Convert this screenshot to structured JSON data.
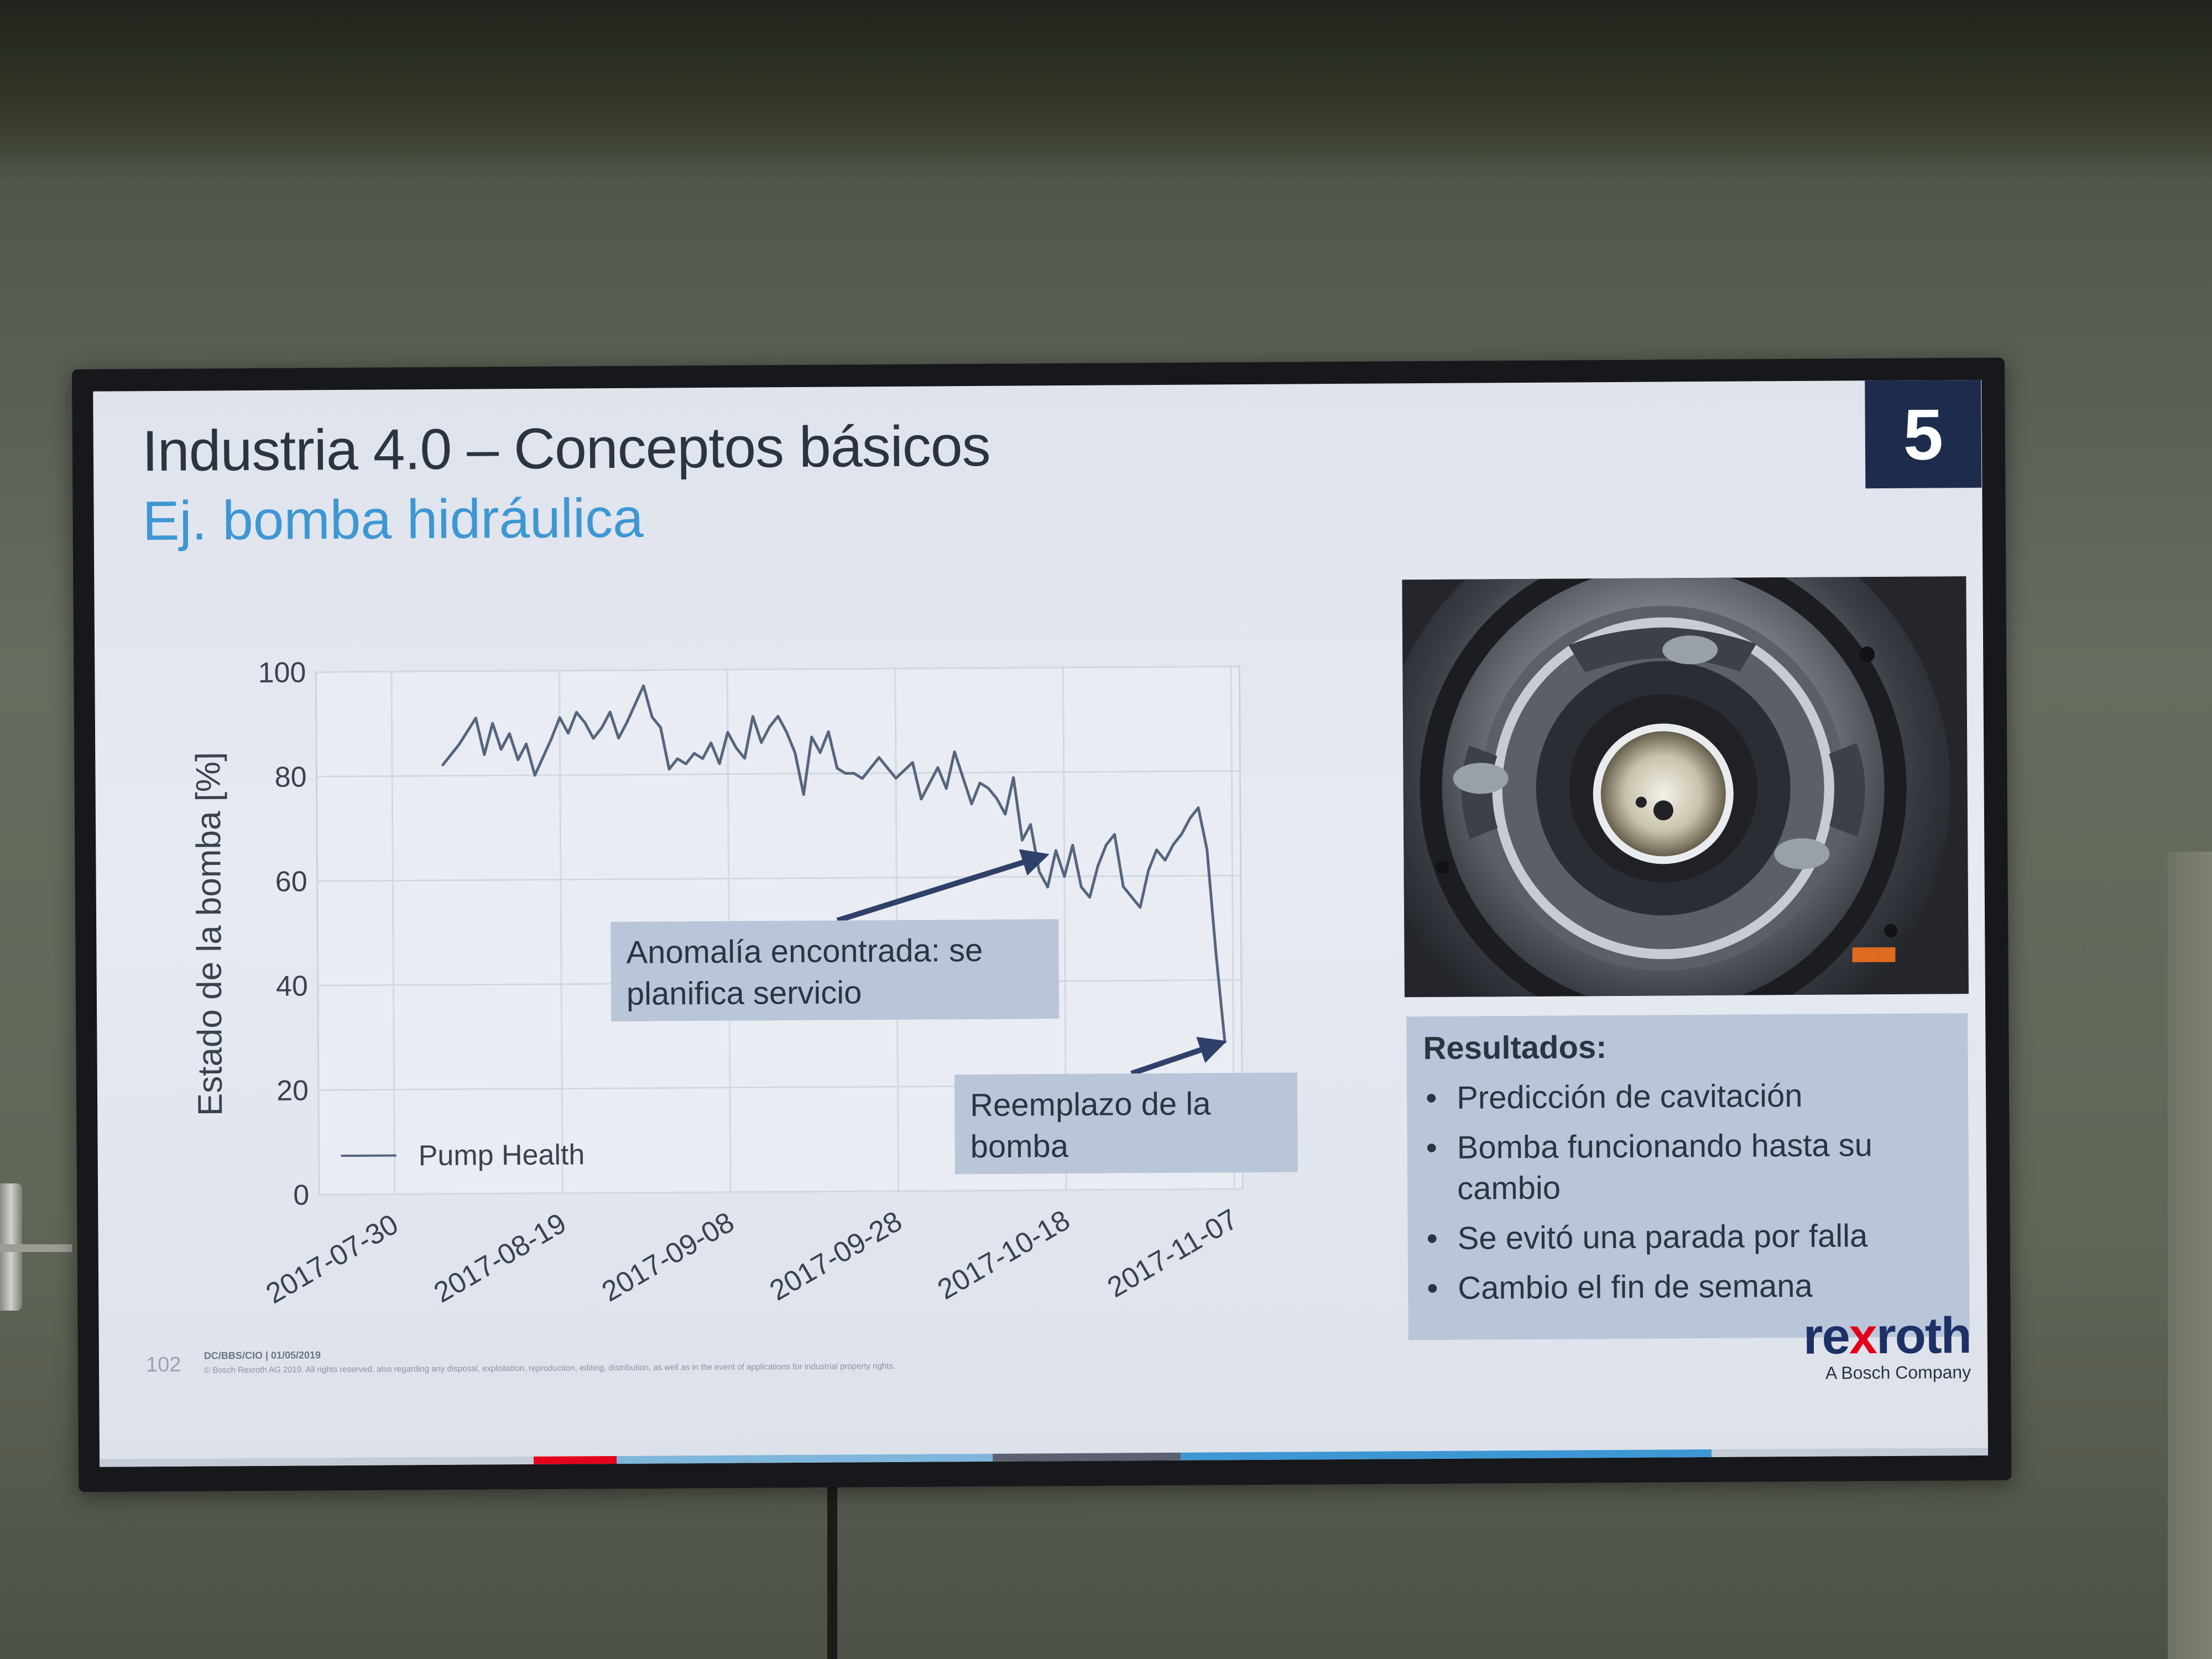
{
  "slide": {
    "title": "Industria 4.0 – Conceptos básicos",
    "subtitle": "Ej. bomba hidráulica",
    "slide_number": "5"
  },
  "chart_data": {
    "type": "line",
    "ylabel": "Estado de la bomba [%]",
    "xlabel": "",
    "ylim": [
      0,
      100
    ],
    "yticks": [
      0,
      20,
      40,
      60,
      80,
      100
    ],
    "xticks": [
      "2017-07-30",
      "2017-08-19",
      "2017-09-08",
      "2017-09-28",
      "2017-10-18",
      "2017-11-07"
    ],
    "xlim": [
      "2017-07-21",
      "2017-11-08"
    ],
    "grid": true,
    "legend_position": "bottom-left",
    "series": [
      {
        "name": "Pump Health",
        "x": [
          "2017-08-05",
          "2017-08-07",
          "2017-08-09",
          "2017-08-10",
          "2017-08-11",
          "2017-08-12",
          "2017-08-13",
          "2017-08-14",
          "2017-08-15",
          "2017-08-16",
          "2017-08-18",
          "2017-08-19",
          "2017-08-20",
          "2017-08-21",
          "2017-08-22",
          "2017-08-23",
          "2017-08-24",
          "2017-08-25",
          "2017-08-26",
          "2017-08-27",
          "2017-08-29",
          "2017-08-30",
          "2017-08-31",
          "2017-09-01",
          "2017-09-02",
          "2017-09-03",
          "2017-09-04",
          "2017-09-05",
          "2017-09-06",
          "2017-09-07",
          "2017-09-08",
          "2017-09-09",
          "2017-09-10",
          "2017-09-11",
          "2017-09-12",
          "2017-09-13",
          "2017-09-14",
          "2017-09-15",
          "2017-09-16",
          "2017-09-17",
          "2017-09-18",
          "2017-09-19",
          "2017-09-20",
          "2017-09-21",
          "2017-09-22",
          "2017-09-23",
          "2017-09-24",
          "2017-09-26",
          "2017-09-28",
          "2017-09-30",
          "2017-10-01",
          "2017-10-03",
          "2017-10-04",
          "2017-10-05",
          "2017-10-06",
          "2017-10-07",
          "2017-10-08",
          "2017-10-09",
          "2017-10-10",
          "2017-10-11",
          "2017-10-12",
          "2017-10-13",
          "2017-10-14",
          "2017-10-15",
          "2017-10-16",
          "2017-10-17",
          "2017-10-18",
          "2017-10-19",
          "2017-10-20",
          "2017-10-21",
          "2017-10-22",
          "2017-10-23",
          "2017-10-24",
          "2017-10-25",
          "2017-10-27",
          "2017-10-28",
          "2017-10-29",
          "2017-10-30",
          "2017-10-31",
          "2017-11-01",
          "2017-11-02",
          "2017-11-03",
          "2017-11-04",
          "2017-11-05",
          "2017-11-06"
        ],
        "values": [
          82,
          86,
          91,
          84,
          90,
          85,
          88,
          83,
          86,
          80,
          87,
          91,
          88,
          92,
          90,
          87,
          89,
          92,
          87,
          90,
          97,
          91,
          89,
          81,
          83,
          82,
          84,
          83,
          86,
          82,
          88,
          85,
          83,
          91,
          86,
          89,
          91,
          88,
          84,
          76,
          87,
          84,
          88,
          81,
          80,
          80,
          79,
          83,
          79,
          82,
          75,
          81,
          77,
          84,
          79,
          74,
          78,
          77,
          75,
          72,
          79,
          67,
          70,
          61,
          58,
          65,
          60,
          66,
          58,
          56,
          62,
          66,
          68,
          58,
          54,
          61,
          65,
          63,
          66,
          68,
          71,
          73,
          65,
          45,
          28
        ]
      }
    ],
    "annotations": [
      {
        "text": "Anomalía encontrada: se planifica servicio",
        "target_x": "2017-10-16",
        "target_y": 64
      },
      {
        "text": "Reemplazo de la bomba",
        "target_x": "2017-11-06",
        "target_y": 28
      }
    ]
  },
  "results": {
    "title": "Resultados:",
    "items": [
      "Predicción de cavitación",
      "Bomba funcionando hasta su cambio",
      "Se evitó una parada por falla",
      "Cambio el fin de semana"
    ]
  },
  "photo": {
    "stamp": "█████"
  },
  "footer": {
    "page": "102",
    "code": "DC/BBS/CIO | 01/05/2019",
    "copyright": "© Bosch Rexroth AG 2019. All rights reserved, also regarding any disposal, exploitation, reproduction, editing, distribution, as well as in the event of applications for industrial property rights."
  },
  "logo": {
    "word_part1": "re",
    "word_x": "x",
    "word_part2": "roth",
    "tagline": "A Bosch Company"
  },
  "colors": {
    "title": "#2c3441",
    "subtitle": "#3d97d3",
    "slide_number_bg": "#1d2b4c",
    "line": "#56657e",
    "annotation_box": "#b9c6d9",
    "arrow": "#2f4168",
    "logo_blue": "#1d3166",
    "logo_red": "#e3001b"
  }
}
